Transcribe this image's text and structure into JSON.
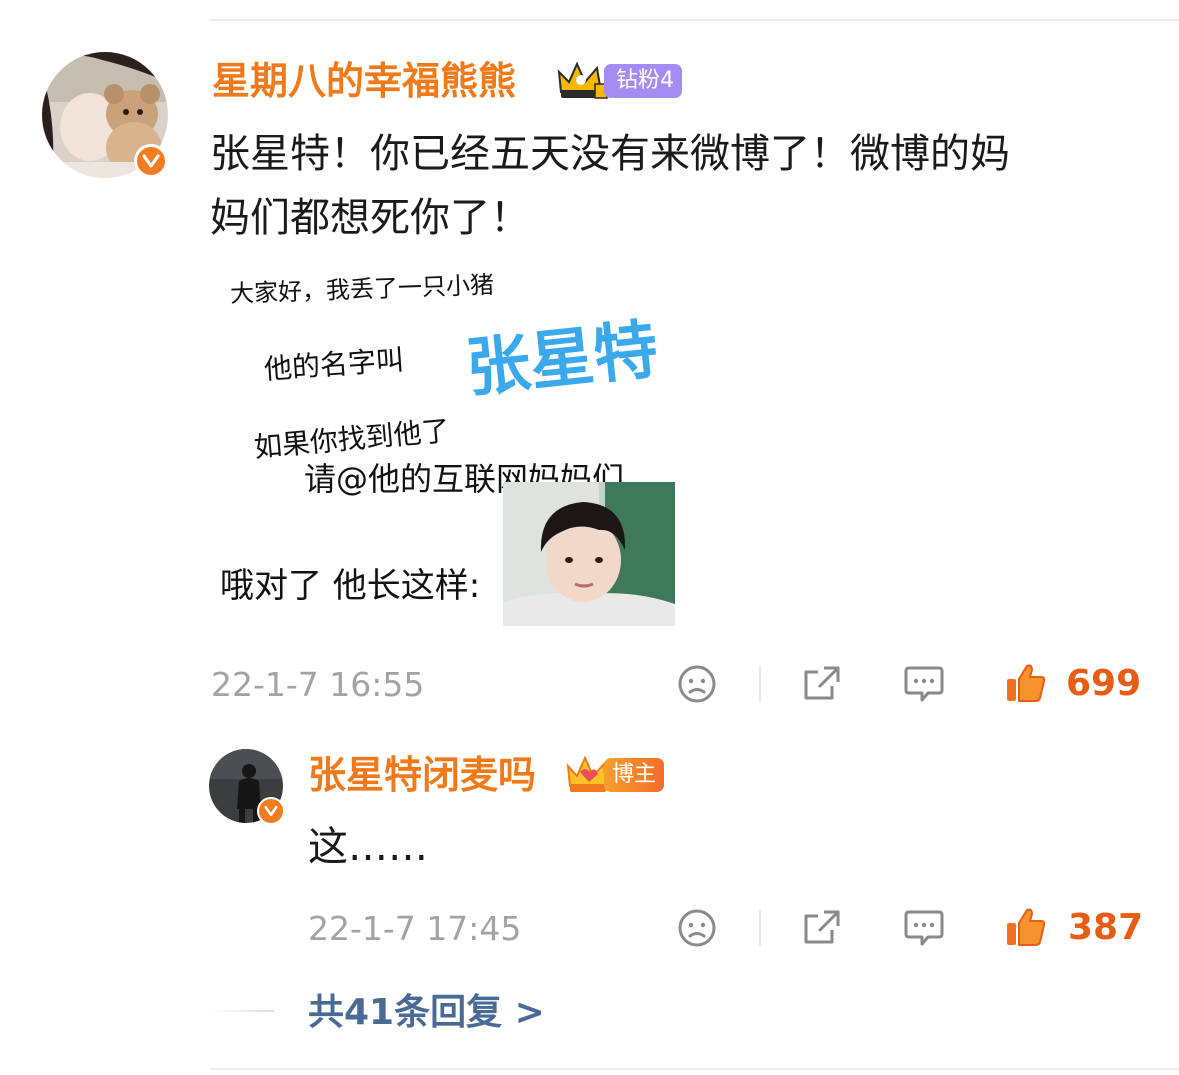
{
  "comment": {
    "username": "星期八的幸福熊熊",
    "badge_text": "钻粉4",
    "text_line1": "张星特！你已经五天没有来微博了！微博的妈",
    "text_line2": "妈们都想死你了！",
    "meme": {
      "line1": "大家好，我丢了一只小猪",
      "line2": "他的名字叫",
      "big_name": "张星特",
      "line3": "如果你找到他了",
      "line4": "请@他的互联网妈妈们",
      "line5": "哦对了  他长这样:"
    },
    "time": "22-1-7 16:55",
    "likes": "699"
  },
  "reply": {
    "username": "张星特闭麦吗",
    "badge_text": "博主",
    "text": "这……",
    "time": "22-1-7 17:45",
    "likes": "387"
  },
  "more_replies": "共41条回复 >",
  "colors": {
    "username": "#f07a1a",
    "like": "#e85d16",
    "link": "#4a6a96",
    "meta": "#a3a3a3"
  },
  "icons": [
    "verified-v-icon",
    "crown-icon",
    "dislike-face-icon",
    "share-icon",
    "comment-icon",
    "like-thumb-icon"
  ]
}
